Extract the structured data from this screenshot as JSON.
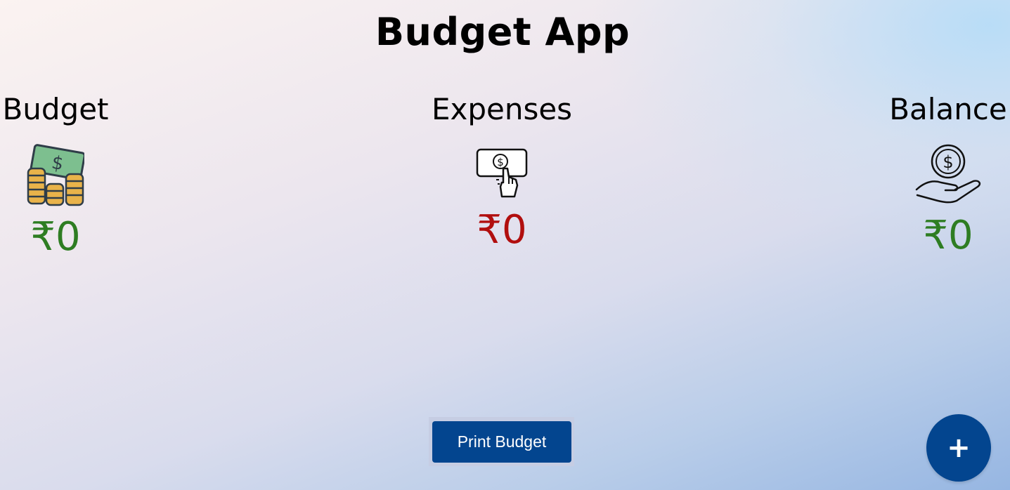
{
  "app": {
    "title": "Budget App"
  },
  "cards": {
    "budget": {
      "label": "Budget",
      "amount": "₹0",
      "icon": "money-stack-icon",
      "color": "#2e7d22"
    },
    "expenses": {
      "label": "Expenses",
      "amount": "₹0",
      "icon": "pay-bill-icon",
      "color": "#b10e0e"
    },
    "balance": {
      "label": "Balance",
      "amount": "₹0",
      "icon": "coin-in-hand-icon",
      "color": "#2e7d22"
    }
  },
  "actions": {
    "print_label": "Print Budget",
    "add_label": "+",
    "accent": "#03458f"
  }
}
